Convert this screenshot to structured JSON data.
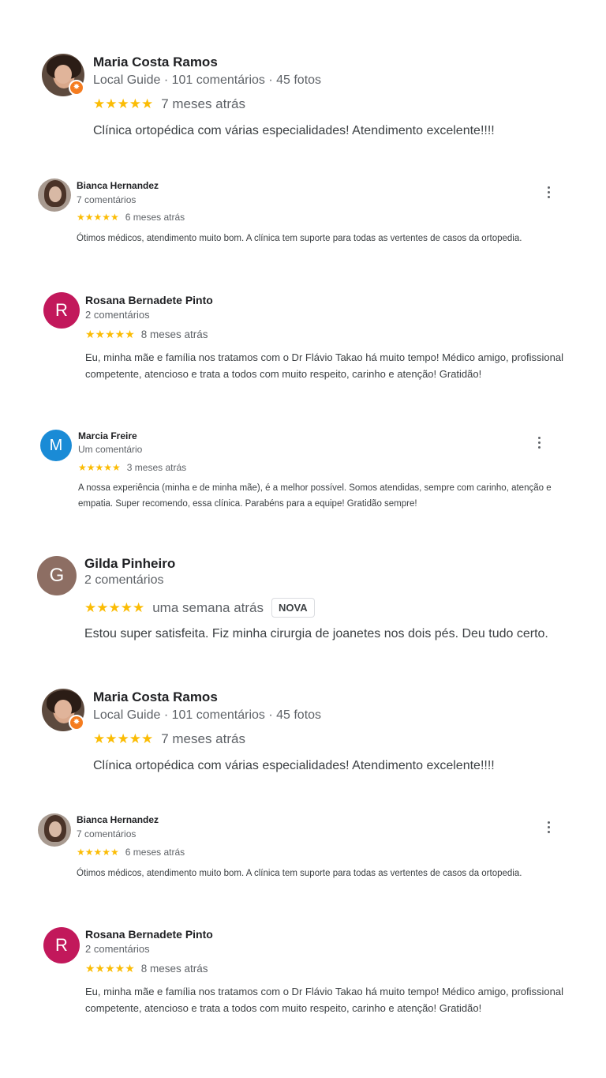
{
  "stars": "★★★★★",
  "reviews": [
    {
      "name": "Maria Costa Ramos",
      "meta": "Local Guide · 101 comentários · 45 fotos",
      "date": "7 meses atrás",
      "text": "Clínica ortopédica com várias especialidades! Atendimento excelente!!!!",
      "avatar": "photo",
      "badge": "local-guide-star"
    },
    {
      "name": "Bianca Hernandez",
      "meta": "7 comentários",
      "date": "6 meses atrás",
      "text": "Ótimos médicos, atendimento muito bom. A clínica tem suporte para todas as vertentes de casos da ortopedia.",
      "avatar": "photo"
    },
    {
      "name": "Rosana Bernadete Pinto",
      "meta": "2 comentários",
      "date": "8 meses atrás",
      "text": "Eu, minha mãe e família nos tratamos com o Dr Flávio Takao há muito tempo! Médico amigo, profissional competente, atencioso e trata a todos com muito respeito, carinho e atenção! Gratidão!",
      "avatar_letter": "R",
      "avatar_color": "#c2185b"
    },
    {
      "name": "Marcia Freire",
      "meta": "Um comentário",
      "date": "3 meses atrás",
      "text": "A nossa experiência (minha e de minha mãe), é a melhor possível. Somos atendidas, sempre com carinho, atenção e empatia. Super recomendo, essa clínica. Parabéns para a equipe! Gratidão sempre!",
      "avatar_letter": "M",
      "avatar_color": "#1a8bd6"
    },
    {
      "name": "Gilda Pinheiro",
      "meta": "2 comentários",
      "date": "uma semana atrás",
      "tag": "NOVA",
      "text": "Estou super satisfeita. Fiz minha cirurgia de joanetes nos dois pés. Deu tudo certo.",
      "avatar_letter": "G",
      "avatar_color": "#8d6e63"
    },
    {
      "name": "Maria Costa Ramos",
      "meta": "Local Guide · 101 comentários · 45 fotos",
      "date": "7 meses atrás",
      "text": "Clínica ortopédica com várias especialidades! Atendimento excelente!!!!",
      "avatar": "photo",
      "badge": "local-guide-star"
    },
    {
      "name": "Bianca Hernandez",
      "meta": "7 comentários",
      "date": "6 meses atrás",
      "text": "Ótimos médicos, atendimento muito bom. A clínica tem suporte para todas as vertentes de casos da ortopedia.",
      "avatar": "photo"
    },
    {
      "name": "Rosana Bernadete Pinto",
      "meta": "2 comentários",
      "date": "8 meses atrás",
      "text": "Eu, minha mãe e família nos tratamos com o Dr Flávio Takao há muito tempo! Médico amigo, profissional competente, atencioso e trata a todos com muito respeito, carinho e atenção! Gratidão!",
      "avatar_letter": "R",
      "avatar_color": "#c2185b"
    }
  ]
}
